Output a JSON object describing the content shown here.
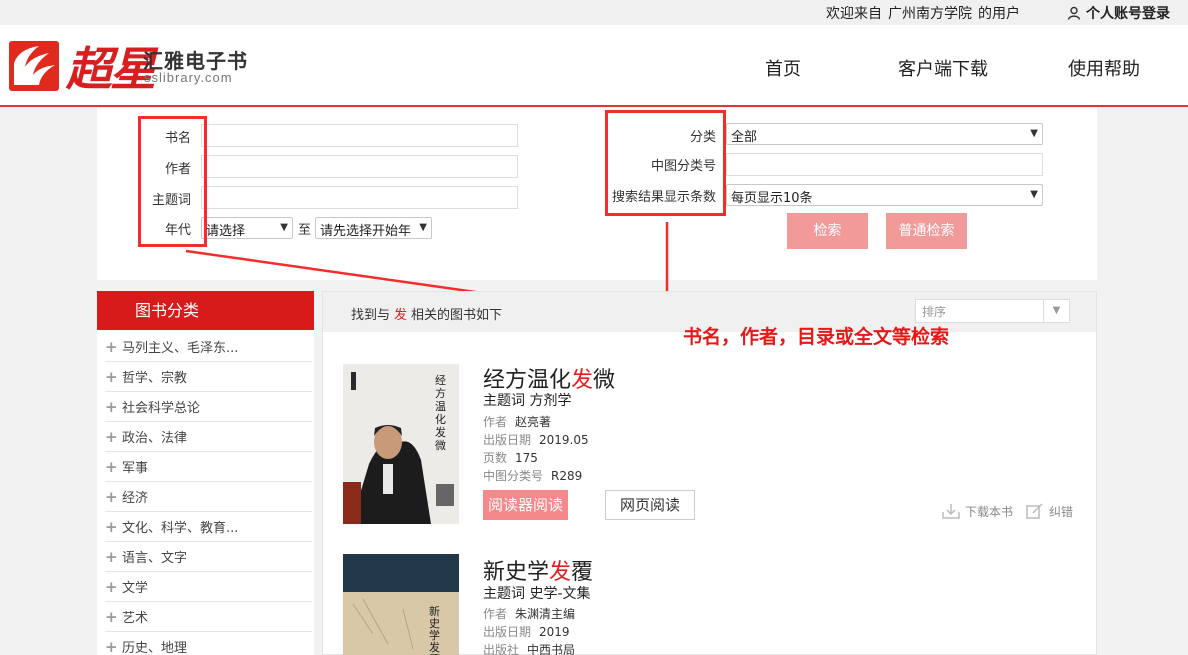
{
  "topbar": {
    "welcome_prefix": "欢迎来自",
    "institution": "广州南方学院",
    "welcome_suffix": "的用户",
    "login": "个人账号登录"
  },
  "header": {
    "logo_cn": "超星",
    "logo_title": "汇雅电子书",
    "logo_sub": "sslibrary.com",
    "nav": [
      "首页",
      "客户端下载",
      "使用帮助"
    ]
  },
  "search": {
    "left_labels": [
      "书名",
      "作者",
      "主题词",
      "年代"
    ],
    "year_from": "请选择",
    "year_to_label": "至",
    "year_to": "请先选择开始年",
    "right_labels": [
      "分类",
      "中图分类号",
      "搜索结果显示条数"
    ],
    "category_value": "全部",
    "per_page_value": "每页显示10条",
    "search_button": "检索",
    "normal_search_button": "普通检索"
  },
  "sidebar": {
    "title": "图书分类",
    "items": [
      "马列主义、毛泽东...",
      "哲学、宗教",
      "社会科学总论",
      "政治、法律",
      "军事",
      "经济",
      "文化、科学、教育...",
      "语言、文字",
      "文学",
      "艺术",
      "历史、地理"
    ]
  },
  "results": {
    "found_prefix": "找到与",
    "keyword": "发",
    "found_suffix": "相关的图书如下",
    "sort_placeholder": "排序",
    "books": [
      {
        "title_pre": "经方温化",
        "title_hl": "发",
        "title_post": "微",
        "subject_label": "主题词",
        "subject": "方剂学",
        "author_label": "作者",
        "author": "赵亮著",
        "date_label": "出版日期",
        "date": "2019.05",
        "pages_label": "页数",
        "pages": "175",
        "class_label": "中图分类号",
        "class": "R289",
        "cover_text": "经方温化发微"
      },
      {
        "title_pre": "新史学",
        "title_hl": "发",
        "title_post": "覆",
        "subject_label": "主题词",
        "subject": "史学-文集",
        "author_label": "作者",
        "author": "朱渊清主编",
        "date_label": "出版日期",
        "date": "2019",
        "publisher_label": "出版社",
        "publisher": "中西书局",
        "cover_text": "新史学发覆"
      }
    ],
    "reader_button": "阅读器阅读",
    "web_button": "网页阅读",
    "download": "下载本书",
    "correct": "纠错"
  },
  "annotation": "书名，作者，目录或全文等检索",
  "colors": {
    "brand_red": "#d71b1b",
    "annotation_red": "#f42c2c",
    "button_pink": "#f2999a"
  }
}
